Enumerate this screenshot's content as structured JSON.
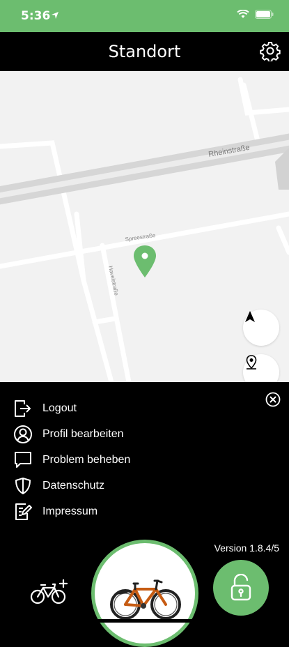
{
  "status_bar": {
    "time": "5:36",
    "icons": [
      "location-arrow-icon",
      "wifi-icon",
      "battery-icon"
    ]
  },
  "header": {
    "title": "Standort",
    "settings_icon": "gear-icon"
  },
  "map": {
    "streets": [
      "Rheinstraße",
      "Spreestraße",
      "Havelstraße"
    ],
    "marker_color": "#6cbd6f",
    "buttons": [
      "navigation-arrow-icon",
      "locate-pin-icon"
    ]
  },
  "menu": {
    "close_icon": "close-circle-icon",
    "items": [
      {
        "label": "Logout",
        "icon": "logout-icon"
      },
      {
        "label": "Profil bearbeiten",
        "icon": "profile-icon"
      },
      {
        "label": "Problem beheben",
        "icon": "chat-bubble-icon"
      },
      {
        "label": "Datenschutz",
        "icon": "shield-icon"
      },
      {
        "label": "Impressum",
        "icon": "edit-document-icon"
      }
    ],
    "version": "Version 1.8.4/5"
  },
  "bottom": {
    "add_bike_icon": "bike-add-icon",
    "unlock_icon": "unlock-icon"
  },
  "colors": {
    "accent": "#6cbd6f",
    "background": "#000000",
    "map": "#f2f2f2"
  }
}
